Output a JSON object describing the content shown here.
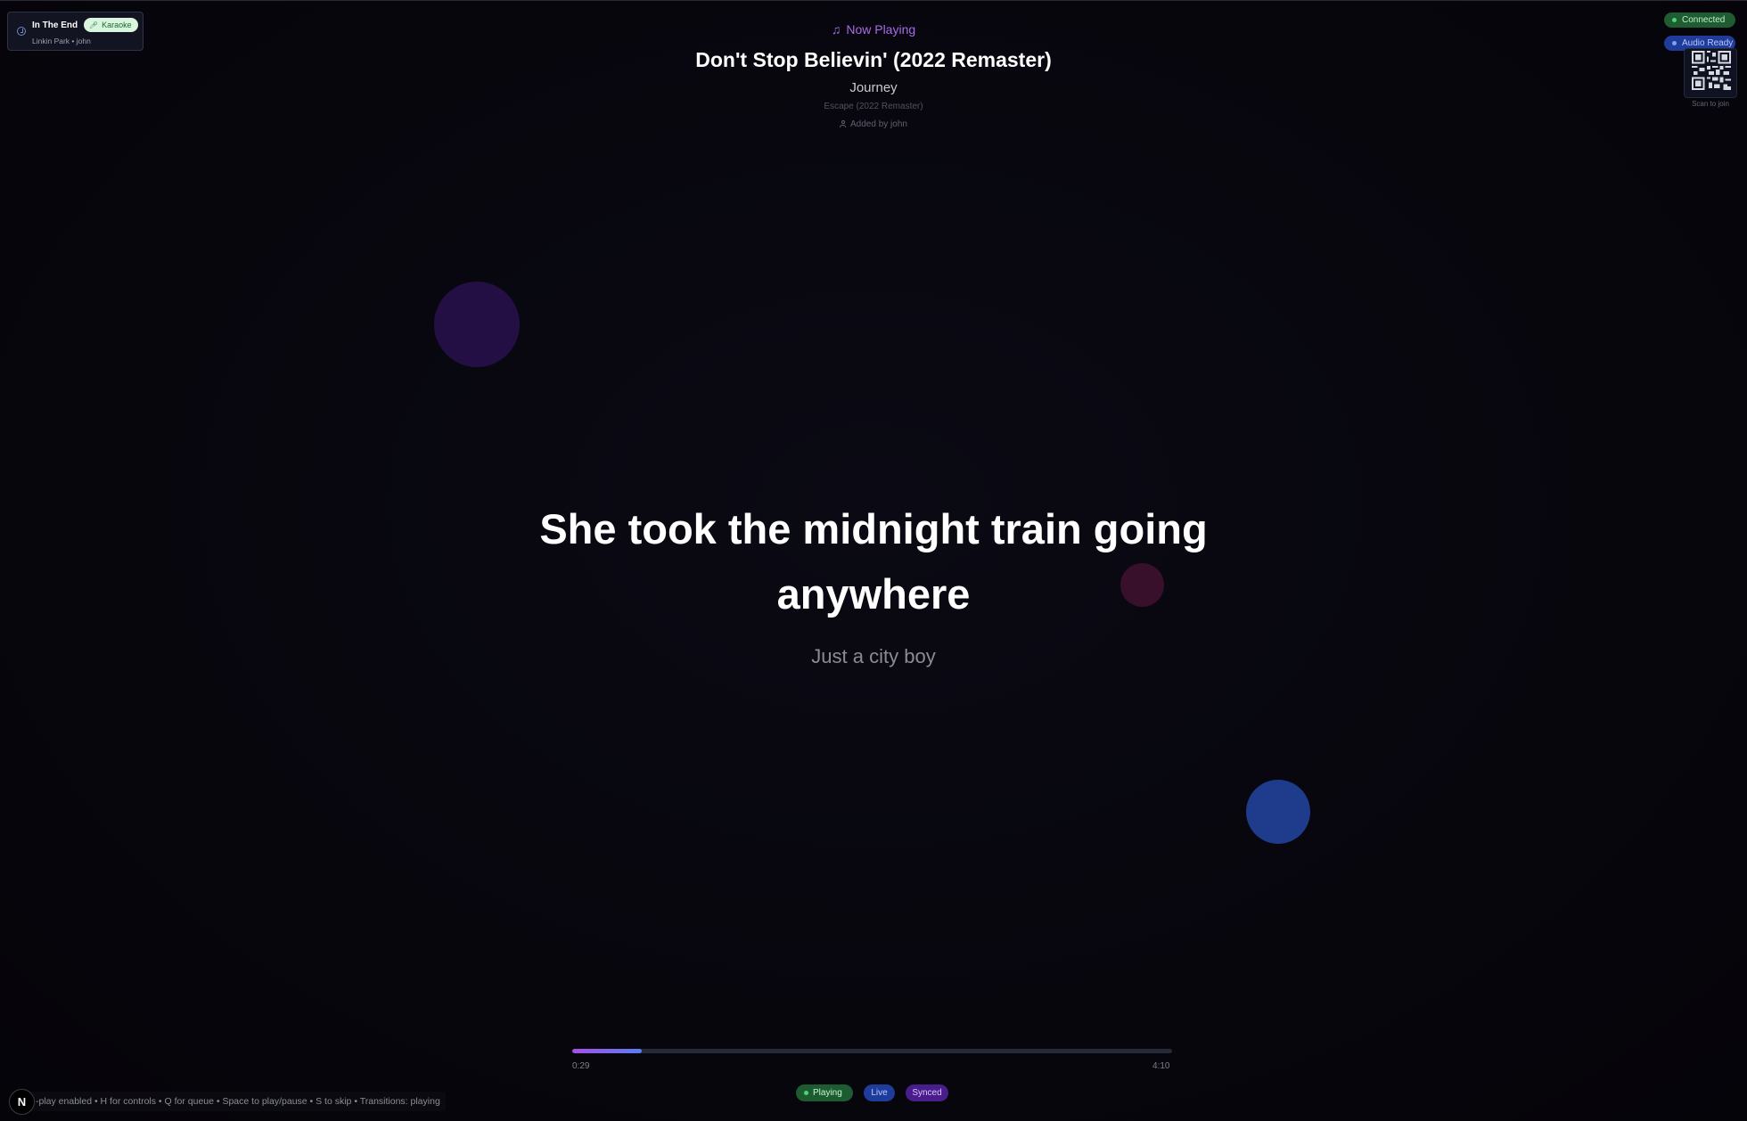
{
  "next_up": {
    "title": "In The End",
    "badge": "Karaoke",
    "subtitle": "Linkin Park • john"
  },
  "now_playing": {
    "label": "Now Playing",
    "title": "Don't Stop Believin' (2022 Remaster)",
    "artist": "Journey",
    "album": "Escape (2022 Remaster)",
    "added_by": "Added by john"
  },
  "status": {
    "connected": "Connected",
    "audio": "Audio Ready",
    "qr_label": "Scan to join"
  },
  "lyrics": {
    "current": "She took the midnight train going anywhere",
    "next": "Just a city boy"
  },
  "progress": {
    "elapsed": "0:29",
    "total": "4:10",
    "fraction": 0.116
  },
  "badges": {
    "playing": "Playing",
    "live": "Live",
    "synced": "Synced"
  },
  "help": {
    "text": "-play enabled • H for controls • Q for queue • Space to play/pause • S to skip • Transitions: playing",
    "logo": "N"
  },
  "colors": {
    "accent_purple": "#a86be6",
    "connected_green": "#1f5c32",
    "audio_blue": "#1f3c9a",
    "synced_purple": "#4a1d8c",
    "background": "#07060d"
  },
  "icons": {
    "next_up": "clock-icon",
    "now_playing": "music-note-icon",
    "added_by": "user-icon",
    "karaoke": "microphone-icon"
  }
}
